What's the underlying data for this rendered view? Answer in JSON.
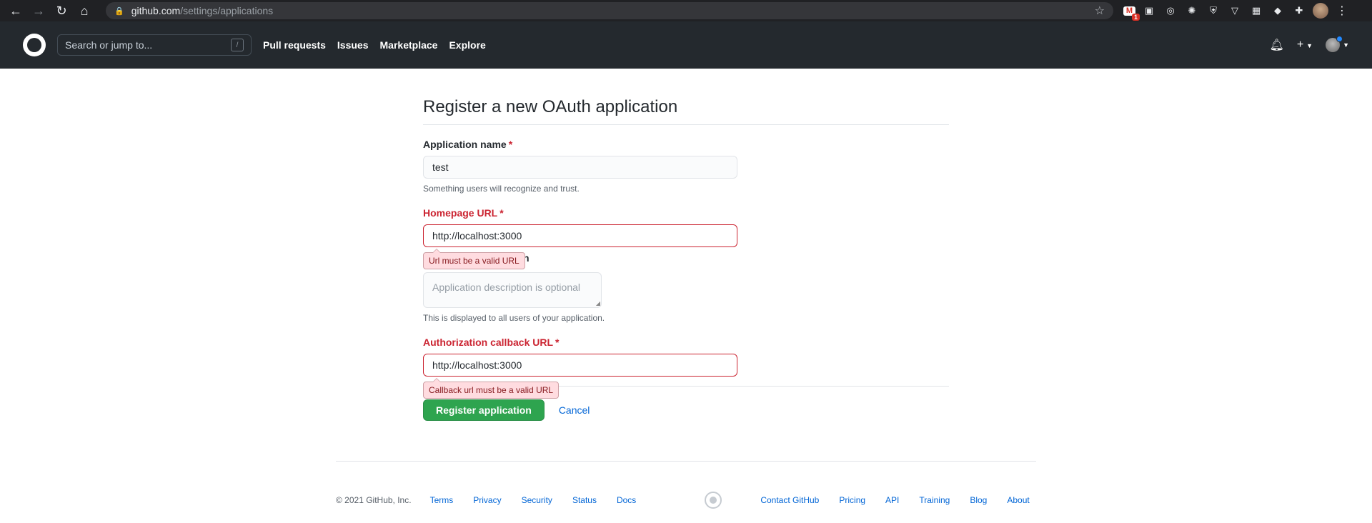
{
  "browser": {
    "url_host": "github.com",
    "url_path": "/settings/applications",
    "gmail_badge": "1"
  },
  "header": {
    "search_placeholder": "Search or jump to...",
    "search_shortcut": "/",
    "nav": [
      "Pull requests",
      "Issues",
      "Marketplace",
      "Explore"
    ]
  },
  "form": {
    "title": "Register a new OAuth application",
    "app_name_label": "Application name",
    "app_name_value": "test",
    "app_name_note": "Something users will recognize and trust.",
    "homepage_label": "Homepage URL",
    "homepage_value": "http://localhost:3000",
    "homepage_error": "Url must be a valid URL",
    "desc_label_visible": "n",
    "desc_placeholder": "Application description is optional",
    "desc_note": "This is displayed to all users of your application.",
    "callback_label": "Authorization callback URL",
    "callback_value": "http://localhost:3000",
    "callback_error": "Callback url must be a valid URL",
    "required_mark": "*",
    "submit_label": "Register application",
    "cancel_label": "Cancel"
  },
  "footer": {
    "copyright": "© 2021 GitHub, Inc.",
    "left_links": [
      "Terms",
      "Privacy",
      "Security",
      "Status",
      "Docs"
    ],
    "right_links": [
      "Contact GitHub",
      "Pricing",
      "API",
      "Training",
      "Blog",
      "About"
    ]
  }
}
